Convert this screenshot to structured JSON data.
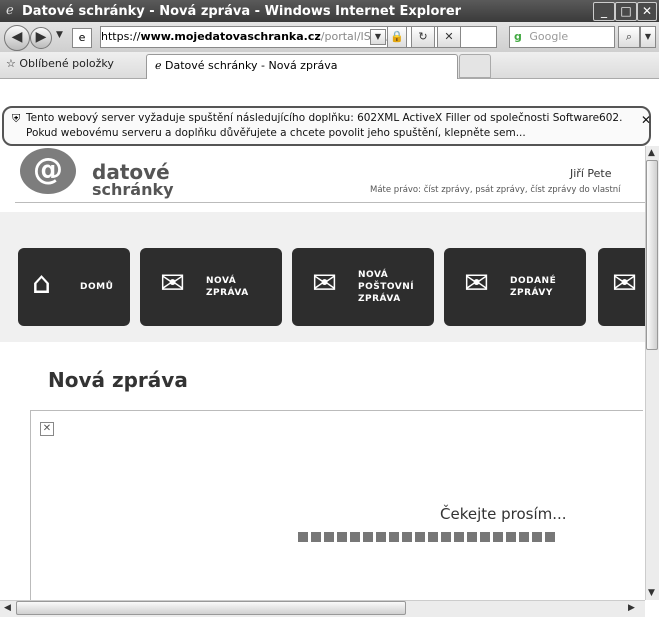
{
  "window": {
    "title": "Datové schránky - Nová zpráva - Windows Internet Explorer"
  },
  "addressbar": {
    "url_prefix": "https://",
    "url_domain": "www.mojedatovaschranka.cz",
    "url_path": "/portal/ISDS/ind",
    "search_placeholder": "Google"
  },
  "favbar": {
    "favorites_label": "Oblíbené položky",
    "tab_label": "Datové schránky - Nová zpráva"
  },
  "infobar": {
    "line1": "Tento webový server vyžaduje spuštění následujícího doplňku: 602XML ActiveX Filler od společnosti Software602.",
    "line2": "Pokud webovému serveru a doplňku důvěřujete a chcete povolit jeho spuštění, klepněte sem..."
  },
  "header": {
    "logo_line1": "datové",
    "logo_line2": "schránky",
    "user_name": "Jiří Pete",
    "rights": "Máte právo: číst zprávy, psát zprávy, číst zprávy do vlastní"
  },
  "nav": {
    "home": "DOMŮ",
    "new_message": [
      "NOVÁ",
      "ZPRÁVA"
    ],
    "new_postal": [
      "NOVÁ",
      "POŠTOVNÍ",
      "ZPRÁVA"
    ],
    "delivered": [
      "DODANÉ",
      "ZPRÁVY"
    ]
  },
  "main": {
    "page_title": "Nová zpráva",
    "wait_text": "Čekejte prosím...",
    "progress_segments": 20
  }
}
